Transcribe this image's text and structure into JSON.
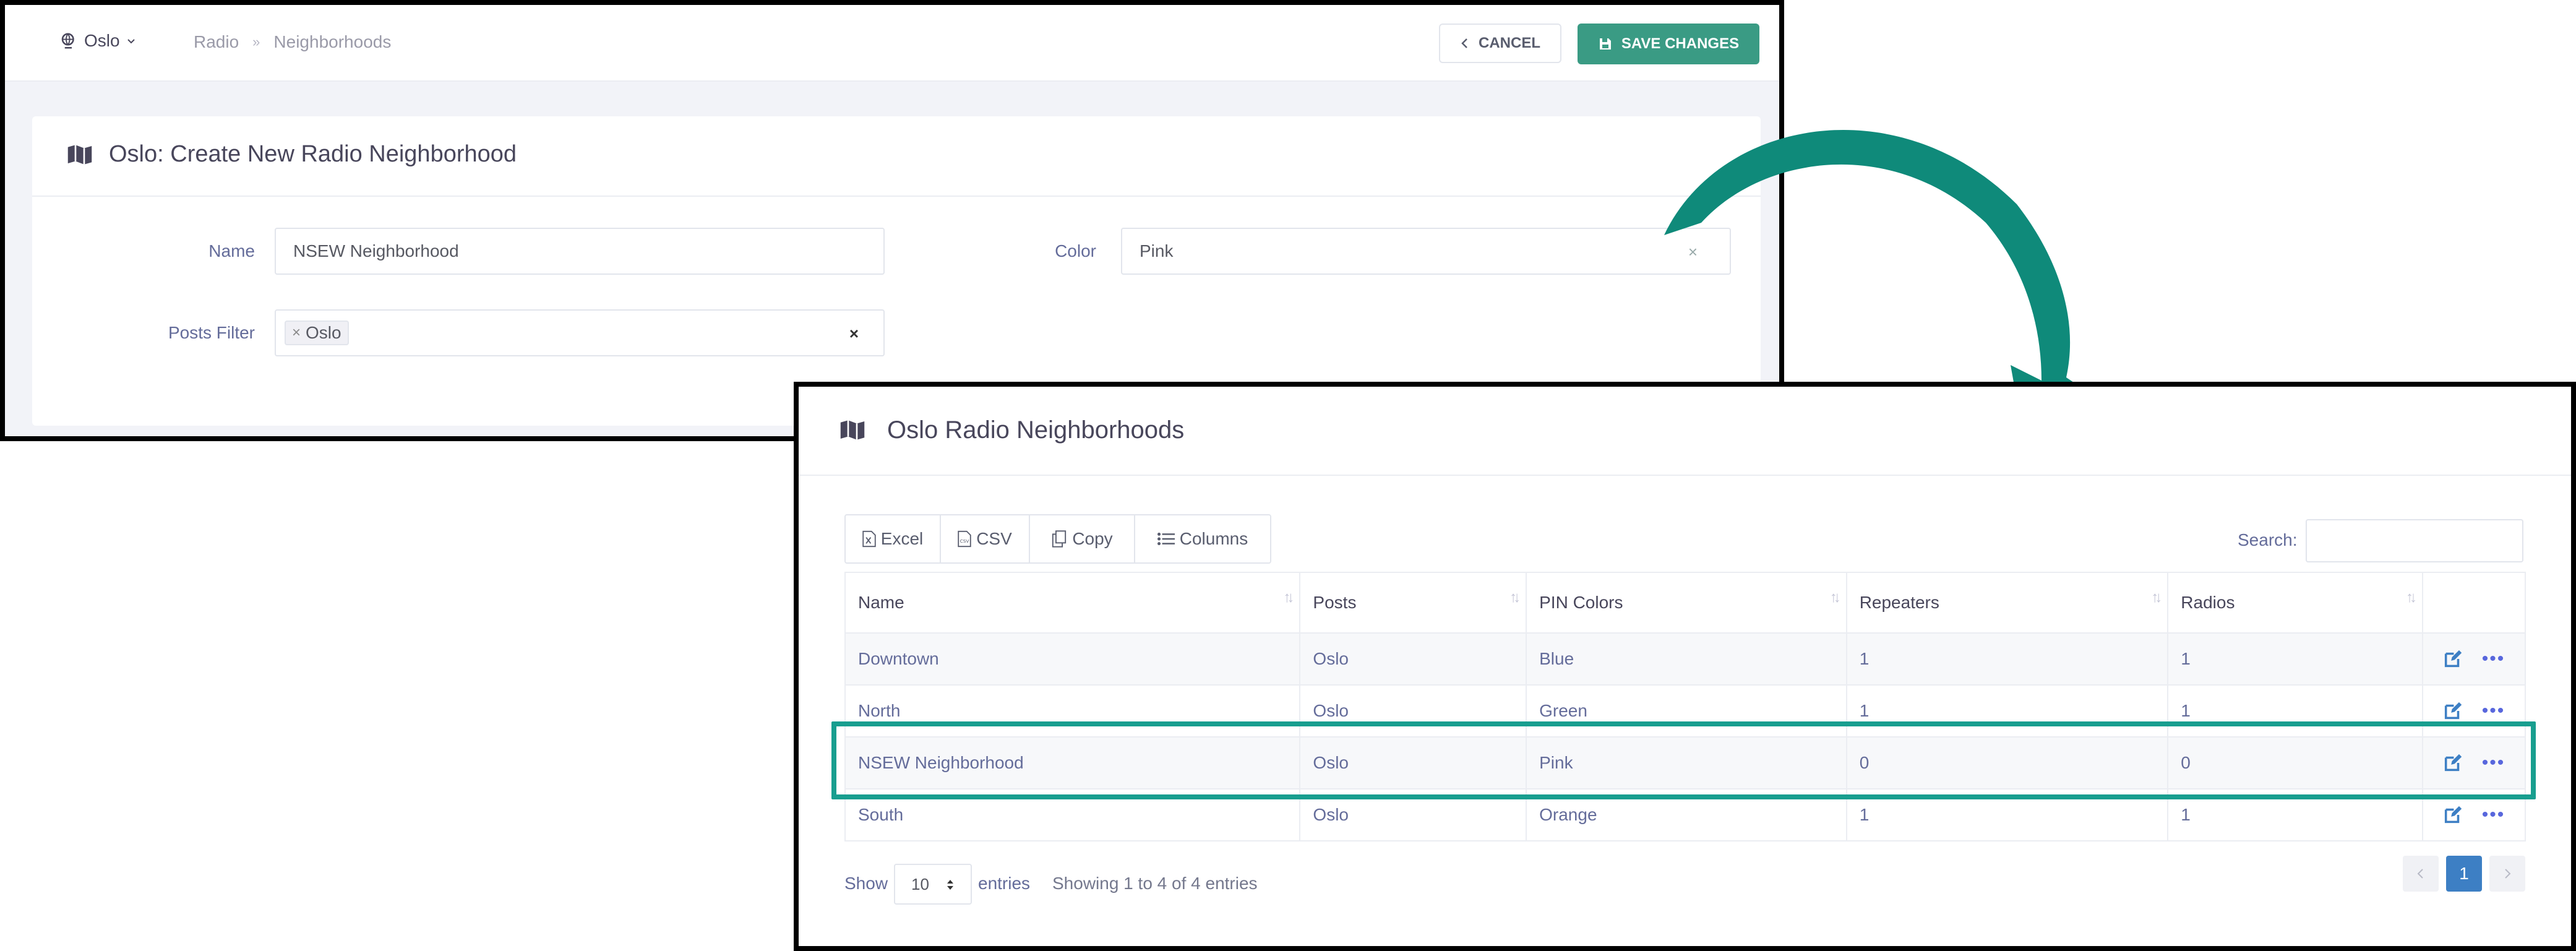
{
  "create_form": {
    "city": "Oslo",
    "breadcrumb": [
      "Radio",
      "Neighborhoods"
    ],
    "breadcrumb_sep": "»",
    "cancel_label": "CANCEL",
    "save_label": "SAVE CHANGES",
    "title": "Oslo: Create New Radio Neighborhood",
    "name_label": "Name",
    "name_value": "NSEW Neighborhood",
    "color_label": "Color",
    "color_value": "Pink",
    "posts_filter_label": "Posts Filter",
    "posts_filter_tag": "Oslo",
    "clear_symbol": "×",
    "tag_remove_symbol": "×"
  },
  "list": {
    "title": "Oslo Radio Neighborhoods",
    "export_buttons": [
      {
        "label": "Excel",
        "icon": "excel-file-icon"
      },
      {
        "label": "CSV",
        "icon": "csv-file-icon"
      },
      {
        "label": "Copy",
        "icon": "copy-icon"
      },
      {
        "label": "Columns",
        "icon": "list-icon"
      }
    ],
    "search_label": "Search:",
    "columns": [
      "Name",
      "Posts",
      "PIN Colors",
      "Repeaters",
      "Radios"
    ],
    "rows": [
      {
        "name": "Downtown",
        "posts": "Oslo",
        "pin_color": "Blue",
        "repeaters": "1",
        "radios": "1"
      },
      {
        "name": "North",
        "posts": "Oslo",
        "pin_color": "Green",
        "repeaters": "1",
        "radios": "1"
      },
      {
        "name": "NSEW Neighborhood",
        "posts": "Oslo",
        "pin_color": "Pink",
        "repeaters": "0",
        "radios": "0"
      },
      {
        "name": "South",
        "posts": "Oslo",
        "pin_color": "Orange",
        "repeaters": "1",
        "radios": "1"
      }
    ],
    "show_label": "Show",
    "page_length": "10",
    "entries_label": "entries",
    "info": "Showing 1 to 4 of 4 entries",
    "current_page": "1",
    "highlighted_row": "NSEW Neighborhood"
  },
  "colors": {
    "accent": "#3a9b84",
    "highlight": "#189e8f",
    "arrow": "#0f8a7a",
    "link_blue": "#5867dd",
    "page_active": "#3d7fc4"
  }
}
